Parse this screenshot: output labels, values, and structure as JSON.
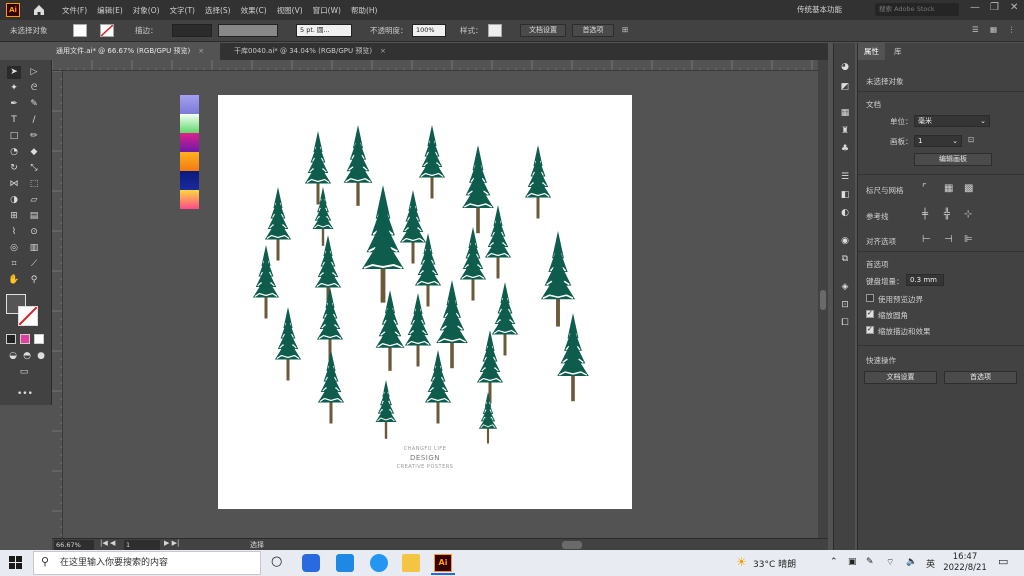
{
  "app": {
    "logo": "Ai",
    "workspace": "传统基本功能",
    "stock_search_placeholder": "搜索 Adobe Stock"
  },
  "menu": [
    "文件(F)",
    "编辑(E)",
    "对象(O)",
    "文字(T)",
    "选择(S)",
    "效果(C)",
    "视图(V)",
    "窗口(W)",
    "帮助(H)"
  ],
  "controlbar": {
    "selection": "未选择对象",
    "stroke_label": "描边：",
    "stroke_profile": "5 pt. 圆...",
    "opacity_label": "不透明度：",
    "opacity_value": "100%",
    "style_label": "样式：",
    "doc_setup": "文档设置",
    "prefs": "首选项"
  },
  "tabs": [
    {
      "label": "通用文件.ai* @ 66.67% (RGB/GPU 预览)",
      "active": true
    },
    {
      "label": "干库0040.ai* @ 34.04% (RGB/GPU 预览)",
      "active": false
    }
  ],
  "artboard": {
    "brand_line1": "CHANGFU LIFE",
    "brand_line2": "DESIGN",
    "brand_line3": "CREATIVE POSTERS",
    "swatch_gradients": [
      [
        "#a6a0f0",
        "#7a7ad8"
      ],
      [
        "#f5fff5",
        "#5fd86a"
      ],
      [
        "#e0208a",
        "#6a1aa8"
      ],
      [
        "#ffb020",
        "#f57a10"
      ],
      [
        "#0a1a7a",
        "#1a2aa0"
      ],
      [
        "#ffd840",
        "#ff4a8a"
      ]
    ]
  },
  "status": {
    "zoom": "66.67%",
    "artboard_num": "1",
    "tool": "选择"
  },
  "panel": {
    "tab_properties": "属性",
    "tab_other": "库",
    "no_selection": "未选择对象",
    "doc_section": "文档",
    "units_label": "单位：",
    "units_value": "毫米",
    "artboard_label": "画板：",
    "artboard_value": "1",
    "edit_artboard": "编辑画板",
    "rulers_grid": "标尺与网格",
    "guides": "参考线",
    "align_to": "对齐选项",
    "prefs_section": "首选项",
    "keyboard_inc_label": "键盘增量：",
    "keyboard_inc_value": "0.3 mm",
    "opt_preview_bounds": "使用预览边界",
    "opt_scale_corners": "缩放圆角",
    "opt_scale_strokes": "缩放描边和效果",
    "quick_actions": "快速操作",
    "btn_doc_setup": "文档设置",
    "btn_prefs": "首选项"
  },
  "checks": {
    "preview_bounds": false,
    "scale_corners": true,
    "scale_strokes": true
  },
  "taskbar": {
    "search_placeholder": "在这里输入你要搜索的内容",
    "weather": "33°C 晴朗",
    "ime": "英",
    "time": "16:47",
    "date": "2022/8/21"
  },
  "colors": {
    "tree": "#0e5c4c",
    "trunk": "#6b5a3a",
    "accent": "#ff9a00"
  }
}
